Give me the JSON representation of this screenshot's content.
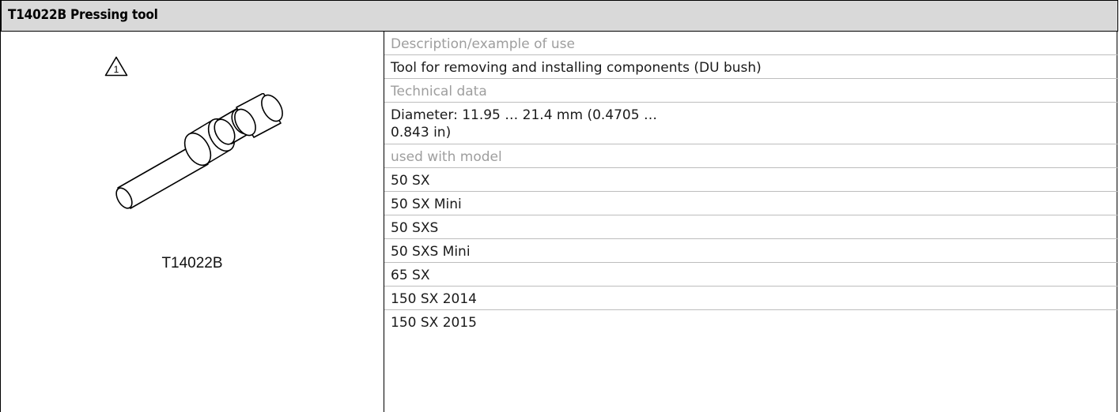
{
  "header": {
    "title": "T14022B Pressing tool"
  },
  "left_panel": {
    "warning_icon_number": "1",
    "part_number": "T14022B"
  },
  "details": {
    "description_label": "Description/example of use",
    "description_value": "Tool for removing and installing components (DU bush)",
    "technical_label": "Technical data",
    "technical_value": "Diameter: 11.95 … 21.4 mm (0.4705 …\n0.843 in)",
    "models_label": "used with model",
    "models": [
      "50 SX",
      "50 SX Mini",
      "50 SXS",
      "50 SXS Mini",
      "65 SX",
      "150 SX 2014",
      "150 SX 2015"
    ]
  }
}
